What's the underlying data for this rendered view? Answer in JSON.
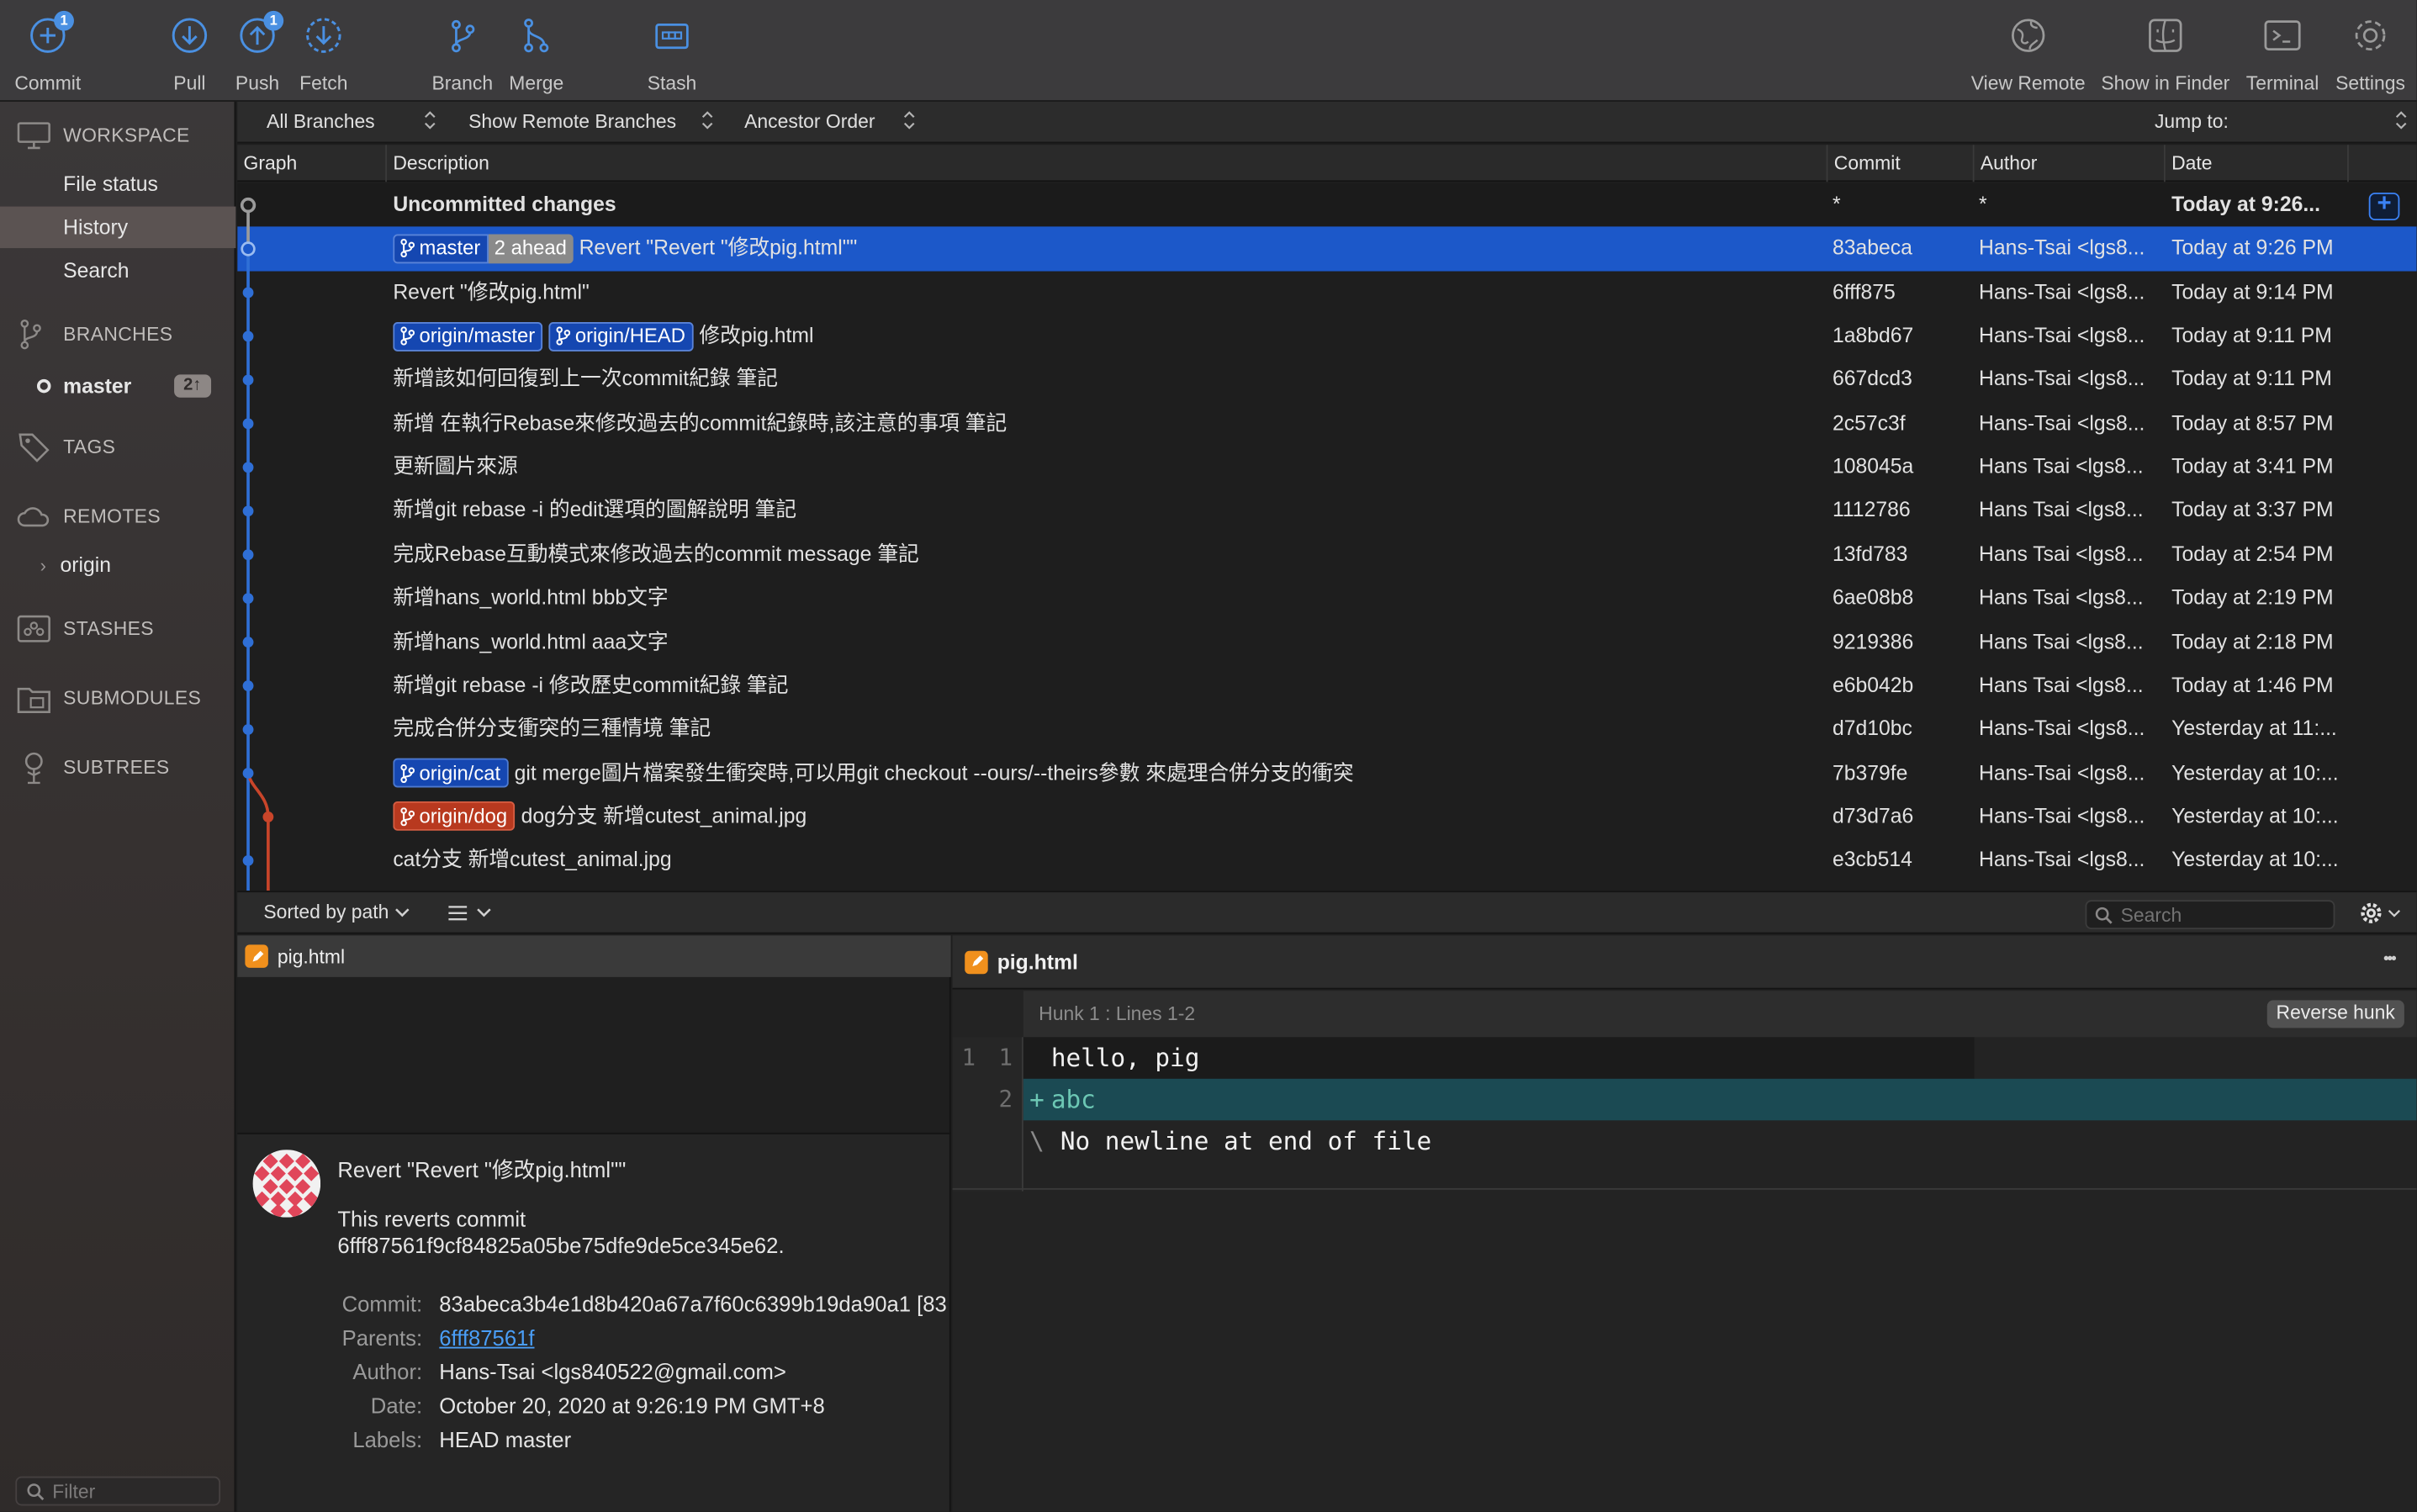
{
  "toolbar": {
    "commit": {
      "label": "Commit",
      "badge": "1"
    },
    "pull": {
      "label": "Pull"
    },
    "push": {
      "label": "Push",
      "badge": "1"
    },
    "fetch": {
      "label": "Fetch"
    },
    "branch": {
      "label": "Branch"
    },
    "merge": {
      "label": "Merge"
    },
    "stash": {
      "label": "Stash"
    },
    "view_remote": {
      "label": "View Remote"
    },
    "show_in_finder": {
      "label": "Show in Finder"
    },
    "terminal": {
      "label": "Terminal"
    },
    "settings": {
      "label": "Settings"
    }
  },
  "sidebar": {
    "workspace": "WORKSPACE",
    "file_status": "File status",
    "history": "History",
    "search": "Search",
    "branches": "BRANCHES",
    "master": "master",
    "master_badge": "2↑",
    "tags": "TAGS",
    "remotes": "REMOTES",
    "origin": "origin",
    "stashes": "STASHES",
    "submodules": "SUBMODULES",
    "subtrees": "SUBTREES",
    "filter_placeholder": "Filter"
  },
  "filterbar": {
    "branches": "All Branches",
    "remote": "Show Remote Branches",
    "order": "Ancestor Order",
    "jump": "Jump to:"
  },
  "columns": {
    "graph": "Graph",
    "description": "Description",
    "commit": "Commit",
    "author": "Author",
    "date": "Date"
  },
  "commits": [
    {
      "tags": [],
      "description": "Uncommitted changes",
      "commit": "*",
      "author": "*",
      "date": "Today at 9:26..."
    },
    {
      "tags": [
        {
          "name": "master",
          "kind": "local",
          "ahead": "2 ahead"
        }
      ],
      "description": "Revert \"Revert \"修改pig.html\"\"",
      "commit": "83abeca",
      "author": "Hans-Tsai <lgs8...",
      "date": "Today at 9:26 PM"
    },
    {
      "tags": [],
      "description": "Revert \"修改pig.html\"",
      "commit": "6fff875",
      "author": "Hans-Tsai <lgs8...",
      "date": "Today at 9:14 PM"
    },
    {
      "tags": [
        {
          "name": "origin/master",
          "kind": "local"
        },
        {
          "name": "origin/HEAD",
          "kind": "local"
        }
      ],
      "description": "修改pig.html",
      "commit": "1a8bd67",
      "author": "Hans-Tsai <lgs8...",
      "date": "Today at 9:11 PM"
    },
    {
      "tags": [],
      "description": "新增該如何回復到上一次commit紀錄 筆記",
      "commit": "667dcd3",
      "author": "Hans-Tsai <lgs8...",
      "date": "Today at 9:11 PM"
    },
    {
      "tags": [],
      "description": "新增 在執行Rebase來修改過去的commit紀錄時,該注意的事項 筆記",
      "commit": "2c57c3f",
      "author": "Hans-Tsai <lgs8...",
      "date": "Today at 8:57 PM"
    },
    {
      "tags": [],
      "description": "更新圖片來源",
      "commit": "108045a",
      "author": "Hans Tsai <lgs8...",
      "date": "Today at 3:41 PM"
    },
    {
      "tags": [],
      "description": "新增git rebase -i 的edit選項的圖解說明 筆記",
      "commit": "1112786",
      "author": "Hans Tsai <lgs8...",
      "date": "Today at 3:37 PM"
    },
    {
      "tags": [],
      "description": "完成Rebase互動模式來修改過去的commit message 筆記",
      "commit": "13fd783",
      "author": "Hans Tsai <lgs8...",
      "date": "Today at 2:54 PM"
    },
    {
      "tags": [],
      "description": "新增hans_world.html bbb文字",
      "commit": "6ae08b8",
      "author": "Hans Tsai <lgs8...",
      "date": "Today at 2:19 PM"
    },
    {
      "tags": [],
      "description": "新增hans_world.html aaa文字",
      "commit": "9219386",
      "author": "Hans Tsai <lgs8...",
      "date": "Today at 2:18 PM"
    },
    {
      "tags": [],
      "description": "新增git rebase -i 修改歷史commit紀錄 筆記",
      "commit": "e6b042b",
      "author": "Hans Tsai <lgs8...",
      "date": "Today at 1:46 PM"
    },
    {
      "tags": [],
      "description": "完成合併分支衝突的三種情境 筆記",
      "commit": "d7d10bc",
      "author": "Hans-Tsai <lgs8...",
      "date": "Yesterday at 11:..."
    },
    {
      "tags": [
        {
          "name": "origin/cat",
          "kind": "remote-cat"
        }
      ],
      "description": "git merge圖片檔案發生衝突時,可以用git checkout --ours/--theirs參數 來處理合併分支的衝突",
      "commit": "7b379fe",
      "author": "Hans-Tsai <lgs8...",
      "date": "Yesterday at 10:..."
    },
    {
      "tags": [
        {
          "name": "origin/dog",
          "kind": "remote-dog"
        }
      ],
      "description": "dog分支 新增cutest_animal.jpg",
      "commit": "d73d7a6",
      "author": "Hans-Tsai <lgs8...",
      "date": "Yesterday at 10:..."
    },
    {
      "tags": [],
      "description": "cat分支 新增cutest_animal.jpg",
      "commit": "e3cb514",
      "author": "Hans-Tsai <lgs8...",
      "date": "Yesterday at 10:..."
    }
  ],
  "bottombar": {
    "sort": "Sorted by path",
    "search_placeholder": "Search"
  },
  "file": {
    "name": "pig.html"
  },
  "details": {
    "title": "Revert \"Revert \"修改pig.html\"\"",
    "body1": "This reverts commit",
    "body2": "6fff87561f9cf84825a05be75dfe9de5ce345e62.",
    "commit_label": "Commit:",
    "commit_value": "83abeca3b4e1d8b420a67a7f60c6399b19da90a1 [83",
    "parents_label": "Parents:",
    "parents_value": "6fff87561f",
    "author_label": "Author:",
    "author_value": "Hans-Tsai <lgs840522@gmail.com>",
    "date_label": "Date:",
    "date_value": "October 20, 2020 at 9:26:19 PM GMT+8",
    "labels_label": "Labels:",
    "labels_value": "HEAD master"
  },
  "diff": {
    "file": "pig.html",
    "hunk": "Hunk 1 : Lines 1-2",
    "reverse": "Reverse hunk",
    "more": "•••",
    "lines": [
      {
        "old": "1",
        "new": "1",
        "prefix": "",
        "text": "hello, pig",
        "kind": "context"
      },
      {
        "old": "",
        "new": "2",
        "prefix": "+",
        "text": "abc",
        "kind": "added"
      },
      {
        "old": "",
        "new": "",
        "prefix": "\\",
        "text": "No newline at end of file",
        "kind": "note"
      }
    ]
  },
  "colors": {
    "accent": "#1c58c9",
    "graph_main": "#2f6fd6",
    "graph_dog": "#c9452a",
    "added_bg": "#1b4a53",
    "added_text": "#6cc7b4"
  }
}
